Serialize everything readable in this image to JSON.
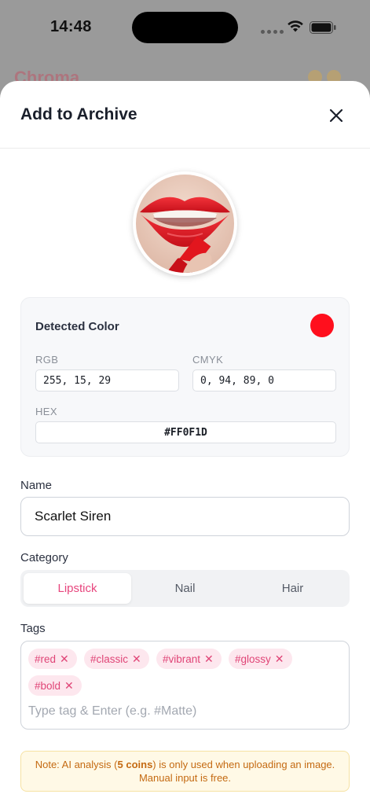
{
  "status_bar": {
    "time": "14:48"
  },
  "sheet": {
    "title": "Add to Archive",
    "close_icon": "close-icon"
  },
  "detected_color": {
    "label": "Detected Color",
    "swatch_color": "#FF0F1D",
    "rgb_label": "RGB",
    "rgb_value": "255, 15, 29",
    "cmyk_label": "CMYK",
    "cmyk_value": "0, 94, 89, 0",
    "hex_label": "HEX",
    "hex_value": "#FF0F1D"
  },
  "name_field": {
    "label": "Name",
    "value": "Scarlet Siren"
  },
  "category": {
    "label": "Category",
    "options": [
      "Lipstick",
      "Nail",
      "Hair"
    ],
    "selected": "Lipstick"
  },
  "tags": {
    "label": "Tags",
    "items": [
      "#red",
      "#classic",
      "#vibrant",
      "#glossy",
      "#bold"
    ],
    "placeholder": "Type tag & Enter (e.g. #Matte)"
  },
  "note": {
    "prefix": "Note: AI analysis (",
    "bold": "5 coins",
    "suffix": ") is only used when uploading an image. Manual input is free."
  },
  "colors": {
    "accent": "#E7457D",
    "tag_bg": "#FDE7EE",
    "note_bg": "#FFF9E6",
    "note_text": "#C46A12"
  }
}
